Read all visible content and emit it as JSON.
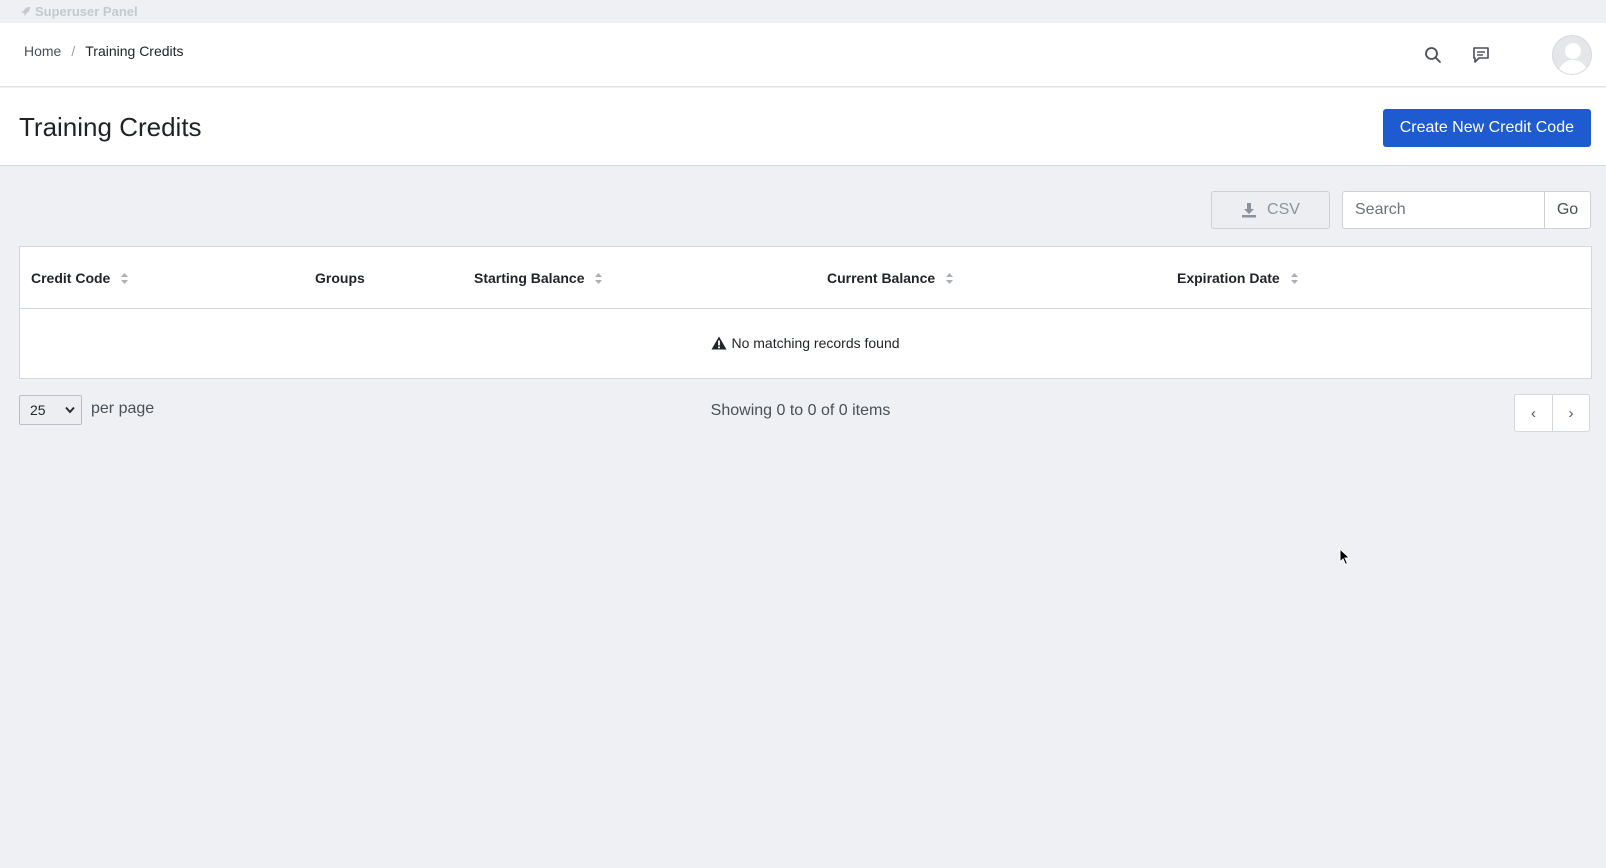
{
  "topbar": {
    "label": "Superuser Panel",
    "icon": "rocket-icon"
  },
  "breadcrumb": [
    {
      "label": "Home"
    },
    {
      "label": "Training Credits"
    }
  ],
  "breadcrumb_separator": "/",
  "header_icons": [
    "search-icon",
    "chat-icon",
    "avatar"
  ],
  "page": {
    "title": "Training Credits",
    "create_button": "Create New Credit Code"
  },
  "toolbar": {
    "csv_label": "CSV",
    "search_placeholder": "Search",
    "go_label": "Go"
  },
  "table": {
    "columns": [
      {
        "label": "Credit Code",
        "sortable": true
      },
      {
        "label": "Groups",
        "sortable": false
      },
      {
        "label": "Starting Balance",
        "sortable": true
      },
      {
        "label": "Current Balance",
        "sortable": true
      },
      {
        "label": "Expiration Date",
        "sortable": true
      }
    ],
    "empty_message": "No matching records found"
  },
  "footer": {
    "per_page_value": "25",
    "per_page_label": "per page",
    "showing": "Showing 0 to 0 of 0 items",
    "prev": "‹",
    "next": "›"
  },
  "colors": {
    "primary": "#1f5bd0",
    "background": "#eef0f3"
  }
}
